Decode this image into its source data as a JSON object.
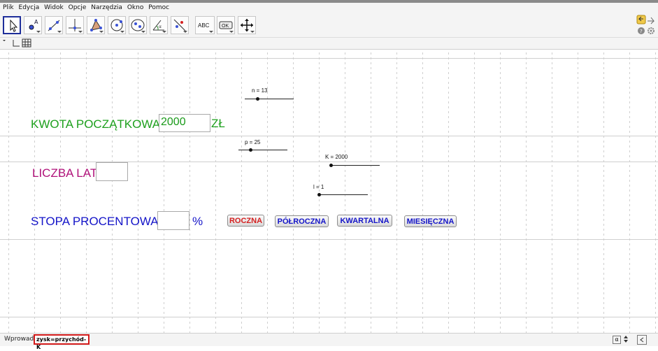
{
  "menu": [
    "Plik",
    "Edycja",
    "Widok",
    "Opcje",
    "Narzędzia",
    "Okno",
    "Pomoc"
  ],
  "toolbar": {
    "tools": [
      {
        "name": "move-tool-icon",
        "active": true
      },
      {
        "name": "point-tool-icon"
      },
      {
        "name": "line-tool-icon"
      },
      {
        "name": "perpendicular-tool-icon"
      },
      {
        "name": "polygon-tool-icon"
      },
      {
        "name": "circle-tool-icon"
      },
      {
        "name": "conic-tool-icon"
      },
      {
        "name": "angle-tool-icon"
      },
      {
        "name": "reflect-tool-icon"
      },
      {
        "name": "text-tool-icon",
        "text": "ABC"
      },
      {
        "name": "button-tool-icon",
        "text": "OK"
      },
      {
        "name": "move-view-tool-icon"
      }
    ]
  },
  "canvas": {
    "kwota_label": "KWOTA POCZĄTKOWA",
    "kwota_value": "2000",
    "kwota_unit": "ZŁ",
    "lata_label": "LICZBA LAT",
    "lata_value": "",
    "stopa_label": "STOPA PROCENTOWA",
    "stopa_value": "",
    "stopa_unit": "%",
    "colors": {
      "green": "#1ea01e",
      "magenta": "#b0127a",
      "blue": "#1414c8",
      "red": "#d42020"
    }
  },
  "sliders": [
    {
      "name": "n",
      "label": "n = 13"
    },
    {
      "name": "p",
      "label": "p = 25"
    },
    {
      "name": "K",
      "label": "K = 2000"
    },
    {
      "name": "l",
      "label": "l = 1"
    }
  ],
  "buttons": [
    {
      "name": "roczna",
      "label": "ROCZNA",
      "color": "#d42020"
    },
    {
      "name": "polroczna",
      "label": "PÓŁROCZNA",
      "color": "#1414c8"
    },
    {
      "name": "kwartalna",
      "label": "KWARTALNA",
      "color": "#1414c8"
    },
    {
      "name": "miesieczna",
      "label": "MIESIĘCZNA",
      "color": "#1414c8"
    }
  ],
  "inputbar": {
    "caption": "Wprowadź:",
    "value": "zysk=przychód-K",
    "alpha": "α"
  }
}
